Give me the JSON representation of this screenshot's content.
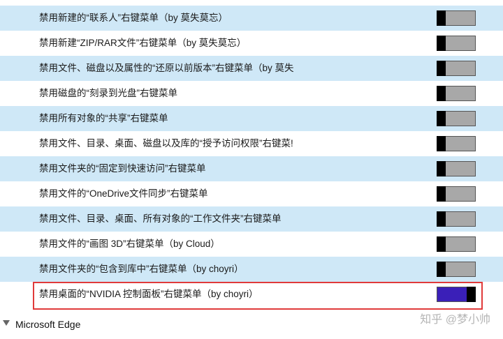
{
  "items": [
    {
      "label": "禁用新建的“联系人”右键菜单（by 莫失莫忘）",
      "state": "off"
    },
    {
      "label": "禁用新建“ZIP/RAR文件”右键菜单（by 莫失莫忘）",
      "state": "off"
    },
    {
      "label": "禁用文件、磁盘以及属性的“还原以前版本”右键菜单（by 莫失",
      "state": "off"
    },
    {
      "label": "禁用磁盘的“刻录到光盘”右键菜单",
      "state": "off"
    },
    {
      "label": "禁用所有对象的“共享”右键菜单",
      "state": "off"
    },
    {
      "label": "禁用文件、目录、桌面、磁盘以及库的“授予访问权限”右键菜!",
      "state": "off"
    },
    {
      "label": "禁用文件夹的“固定到快速访问”右键菜单",
      "state": "off"
    },
    {
      "label": "禁用文件的“OneDrive文件同步”右键菜单",
      "state": "off"
    },
    {
      "label": "禁用文件、目录、桌面、所有对象的“工作文件夹”右键菜单",
      "state": "off"
    },
    {
      "label": "禁用文件的“画图 3D”右键菜单（by Cloud）",
      "state": "off"
    },
    {
      "label": "禁用文件夹的“包含到库中”右键菜单（by choyri）",
      "state": "off"
    },
    {
      "label": "禁用桌面的“NVIDIA 控制面板”右键菜单（by choyri）",
      "state": "on"
    }
  ],
  "section": {
    "label": "Microsoft Edge"
  },
  "watermark": "知乎 @梦小帅",
  "colors": {
    "row_alt": "#cfe8f7",
    "toggle_on": "#3a1fb8",
    "toggle_off": "#a8a8a8",
    "highlight": "#e03a3a"
  }
}
